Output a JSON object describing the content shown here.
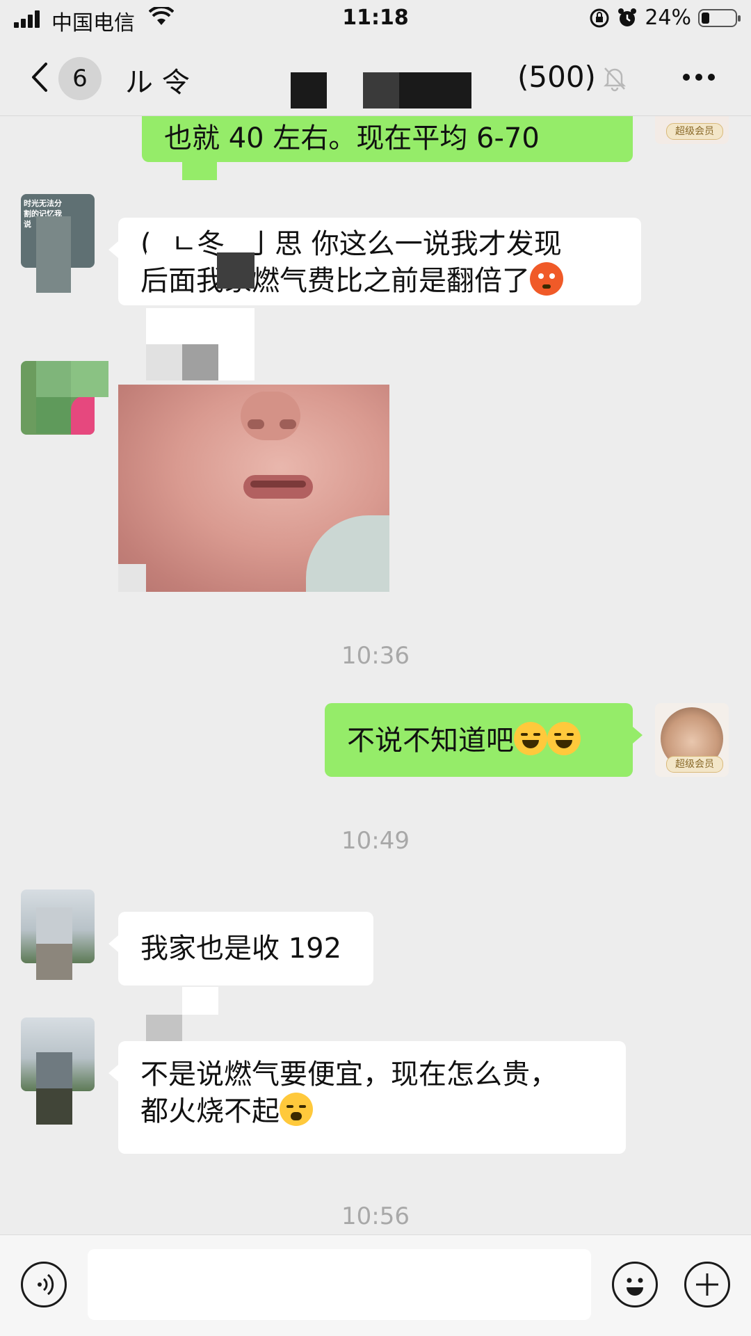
{
  "status_bar": {
    "carrier": "中国电信",
    "time": "11:18",
    "battery": "24%",
    "battery_level": 0.24,
    "icons": [
      "signal-icon",
      "wifi-icon",
      "rotation-lock-icon",
      "alarm-icon",
      "battery-icon"
    ]
  },
  "nav": {
    "unread_count": "6",
    "title_fragment": "ル  令",
    "member_count": "(500)",
    "icons": [
      "back-icon",
      "mute-bell-icon",
      "more-icon"
    ]
  },
  "messages": [
    {
      "type": "text",
      "side": "right",
      "text": "也就 40 左右。现在平均 6-70"
    },
    {
      "type": "text",
      "side": "left",
      "lines": [
        "(   ㄴ冬    亅思 你这么一说我才发现",
        "后面我家燃气费比之前是翻倍了"
      ],
      "emoji": "hot-face-emoji"
    },
    {
      "type": "image",
      "side": "left",
      "description_icon": "sticker-image"
    },
    {
      "type": "time",
      "text": "10:36"
    },
    {
      "type": "text",
      "side": "right",
      "text": "不说不知道吧",
      "emoji": [
        "tears-of-joy-emoji",
        "tears-of-joy-emoji"
      ]
    },
    {
      "type": "time",
      "text": "10:49"
    },
    {
      "type": "text",
      "side": "left",
      "text": "我家也是收 192"
    },
    {
      "type": "text",
      "side": "left",
      "lines": [
        "不是说燃气要便宜，现在怎么贵，",
        "都火烧不起"
      ],
      "emoji": "crying-emoji"
    },
    {
      "type": "time",
      "text": "10:56"
    }
  ],
  "avatar_badge": "超级会员",
  "avatar_text": "时光无法分割的记忆我说",
  "input_bar": {
    "placeholder": "",
    "icons": [
      "voice-icon",
      "emoji-icon",
      "plus-icon"
    ]
  },
  "colors": {
    "background": "#ededed",
    "bubble_self": "#95ec69",
    "bubble_other": "#ffffff",
    "timestamp": "#a8a8a8"
  }
}
